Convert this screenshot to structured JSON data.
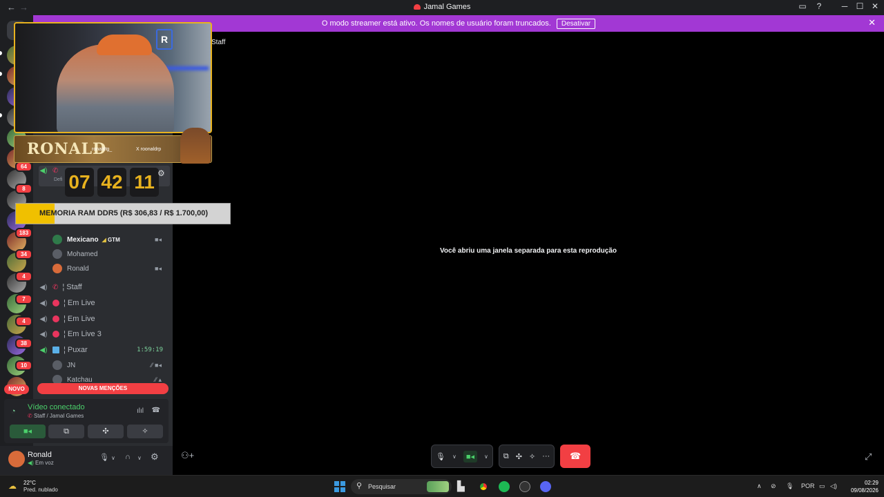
{
  "window": {
    "title": "Jamal Games",
    "back": "←",
    "forward": "→",
    "inbox_icon": "inbox-icon",
    "help_icon": "help-icon",
    "minimize": "─",
    "maximize": "☐",
    "close": "✕"
  },
  "banner": {
    "text": "O modo streamer está ativo. Os nomes de usuário foram truncados.",
    "button": "Desativar",
    "close": "✕"
  },
  "guilds": {
    "badges": [
      "64",
      "8",
      "183",
      "34",
      "4",
      "7",
      "4",
      "38",
      "10"
    ],
    "new_label": "NOVO"
  },
  "sidebar": {
    "default_channel_sub": "Defi",
    "users_top": [
      {
        "name": "Mexicano",
        "badge": "GTM",
        "camera": true
      },
      {
        "name": "Mohamed",
        "camera": false
      },
      {
        "name": "Ronald",
        "camera": true
      }
    ],
    "channels": [
      {
        "label": "¦ Staff",
        "type": "phone"
      },
      {
        "label": "¦ Em Live",
        "type": "dot"
      },
      {
        "label": "¦ Em Live",
        "type": "dot"
      },
      {
        "label": "¦ Em Live 3",
        "type": "dot"
      },
      {
        "label": "¦ Puxar",
        "type": "tag",
        "time": "1:59:19"
      }
    ],
    "users_bottom": [
      {
        "name": "JN"
      },
      {
        "name": "Katchau"
      }
    ],
    "mentions": "NOVAS MENÇÕES"
  },
  "voice": {
    "status": "Vídeo conectado",
    "location": "Staff / Jamal Games"
  },
  "user": {
    "name": "Ronald",
    "status": "Em voz"
  },
  "main": {
    "channel_title": "Staff",
    "popout_message": "Você abriu uma janela separada para esta reprodução"
  },
  "overlay": {
    "streamer_name": "RONALD",
    "handle_1": "ronaldtg_",
    "handle_2": "X roonaldrp",
    "timer_hours": "07",
    "timer_minutes": "42",
    "timer_seconds": "11",
    "goal_text": "MEMORIA RAM DDR5 (R$ 306,83 / R$ 1.700,00)",
    "goal_progress": 0.18,
    "brand_letter": "R"
  },
  "taskbar": {
    "temperature": "22°C",
    "weather": "Pred. nublado",
    "search": "Pesquisar",
    "language": "POR",
    "time": "02:29",
    "date": "09/08/2026"
  },
  "colors": {
    "banner": "#a238d4",
    "accent_green": "#4bd06b",
    "danger": "#f23f43",
    "overlay_gold": "#e8b21e"
  }
}
